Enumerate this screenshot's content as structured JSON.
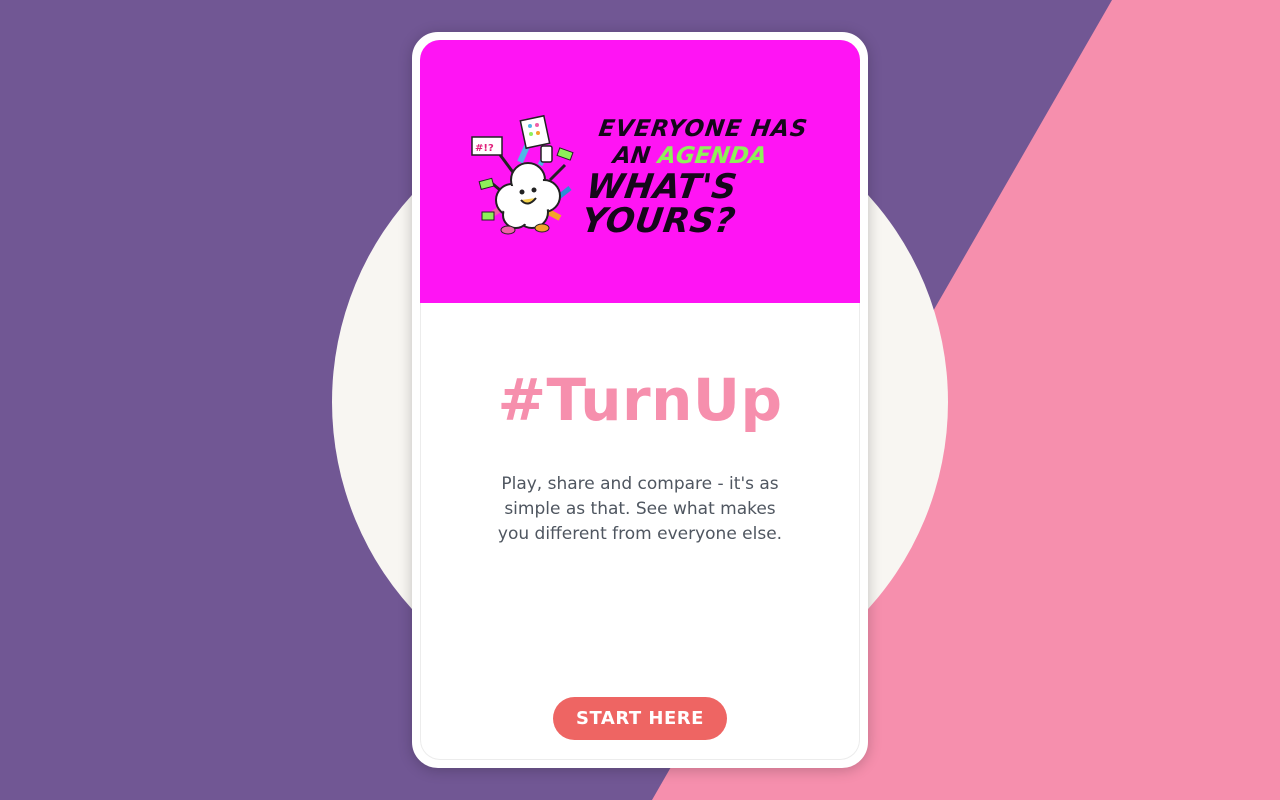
{
  "colors": {
    "background_purple": "#715794",
    "background_pink": "#f68fad",
    "circle": "#f8f6f2",
    "banner": "#ff14f4",
    "title": "#f68fad",
    "button": "#ee6563",
    "agenda_highlight": "#8ef05a"
  },
  "banner": {
    "tagline_line1": "Everyone has",
    "tagline_line2_prefix": "an",
    "tagline_line2_highlight": "Agenda",
    "tagline_line3": "What's yours?",
    "sign_text": "#!?"
  },
  "main": {
    "title": "#TurnUp",
    "description": "Play, share and compare - it's as simple as that. See what makes you different from everyone else."
  },
  "actions": {
    "start_label": "START HERE"
  }
}
